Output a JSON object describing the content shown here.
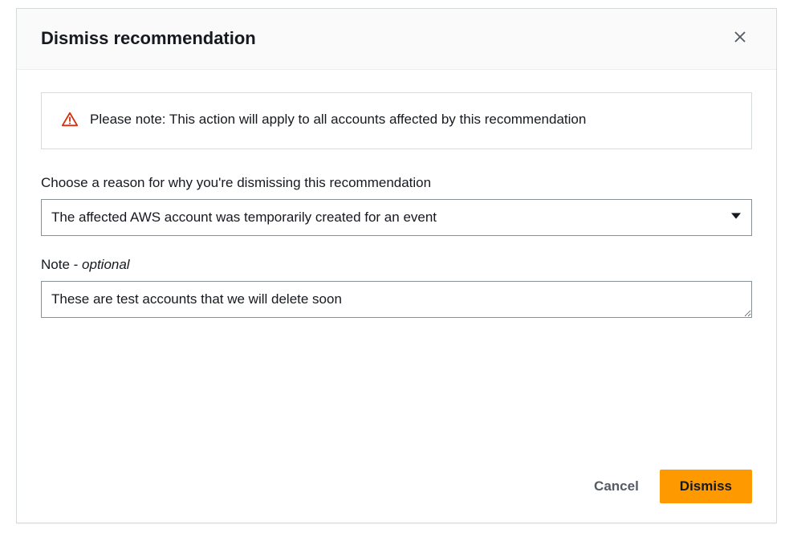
{
  "modal": {
    "title": "Dismiss recommendation",
    "alert": {
      "text": "Please note: This action will apply to all accounts affected by this recommendation"
    },
    "reason": {
      "label": "Choose a reason for why you're dismissing this recommendation",
      "selected": "The affected AWS account was temporarily created for an event"
    },
    "note": {
      "label_prefix": "Note - ",
      "label_optional": "optional",
      "value": "These are test accounts that we will delete soon"
    },
    "footer": {
      "cancel": "Cancel",
      "dismiss": "Dismiss"
    }
  }
}
